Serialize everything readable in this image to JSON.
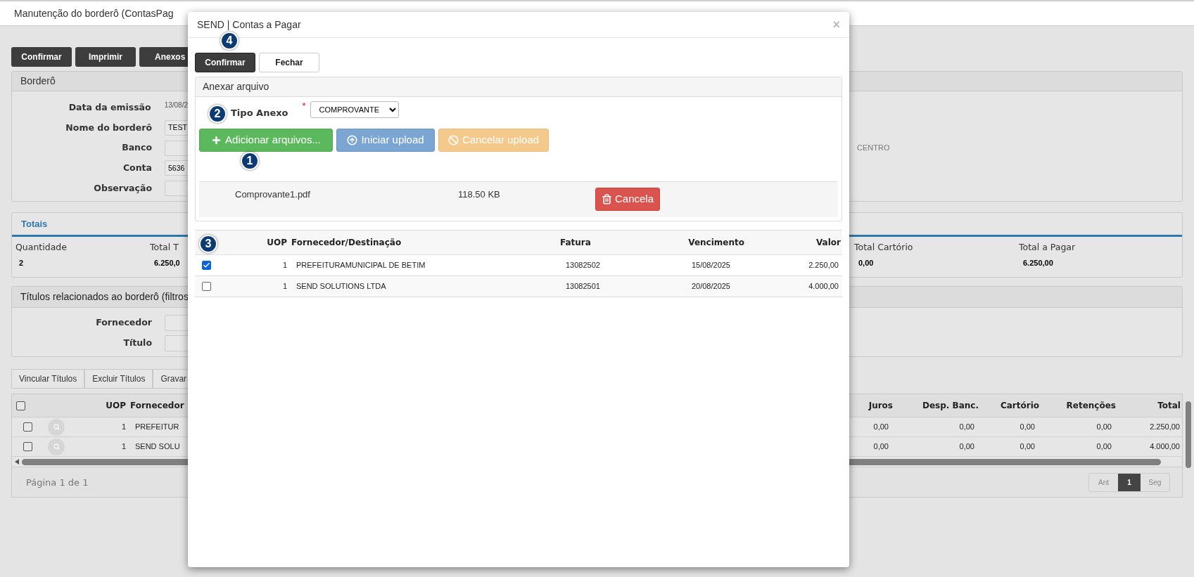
{
  "page": {
    "title": "Manutenção do borderô (ContasPag",
    "buttons": [
      "Confirmar",
      "Imprimir",
      "Anexos"
    ]
  },
  "bordero": {
    "title": "Borderô",
    "fields": [
      {
        "label": "Data da emissão",
        "kind": "text",
        "value": "13/08/2"
      },
      {
        "label": "Nome do borderô",
        "kind": "input",
        "value": "TEST"
      },
      {
        "label": "Banco",
        "kind": "input",
        "side_text": "CENTRO"
      },
      {
        "label": "Conta",
        "kind": "input",
        "value": "5636"
      },
      {
        "label": "Observação",
        "kind": "input"
      }
    ]
  },
  "totais": {
    "title": "Totais",
    "left": [
      {
        "label": "Quantidade",
        "value": "2"
      },
      {
        "label": "Total T",
        "value": "6.250,0"
      }
    ],
    "right": [
      {
        "label": "Total Cartório",
        "value": "0,00"
      },
      {
        "label": "Total a Pagar",
        "value": "6.250,00"
      }
    ]
  },
  "titulos": {
    "title": "Títulos relacionados ao borderô (filtros",
    "fields": [
      {
        "label": "Fornecedor"
      },
      {
        "label": "Título"
      }
    ]
  },
  "tabs": [
    "Vincular Títulos",
    "Excluir Títulos",
    "Gravar"
  ],
  "grid": {
    "all_checked": false,
    "left_columns": [
      "UOP",
      "Fornecedor"
    ],
    "right_columns": [
      "Juros",
      "Desp. Banc.",
      "Cartório",
      "Retenções",
      "Total"
    ],
    "rows": [
      {
        "checked": false,
        "uop": "1",
        "name": "PREFEITUR",
        "values": [
          "0,00",
          "0,00",
          "0,00",
          "0,00",
          "2.250,00"
        ]
      },
      {
        "checked": false,
        "uop": "1",
        "name": "SEND SOLU",
        "values": [
          "0,00",
          "0,00",
          "0,00",
          "0,00",
          "4.000,00"
        ]
      }
    ]
  },
  "pager": {
    "text": "Página 1 de 1",
    "pages": [
      {
        "label": "Ant",
        "selected": false
      },
      {
        "label": "1",
        "selected": true
      },
      {
        "label": "Seg",
        "selected": false
      }
    ]
  },
  "modal": {
    "title": "SEND | Contas a Pagar",
    "close": "×",
    "buttons": [
      {
        "label": "Confirmar",
        "kind": "primary"
      },
      {
        "label": "Fechar",
        "kind": "default"
      }
    ],
    "panel_title": "Anexar arquivo",
    "tipo_label": "Tipo Anexo",
    "required_mark": "*",
    "tipo_value": "COMPROVANTE",
    "upload_buttons": [
      {
        "label": "Adicionar arquivos...",
        "kind": "add"
      },
      {
        "label": "Iniciar upload",
        "kind": "start"
      },
      {
        "label": "Cancelar upload",
        "kind": "cancel"
      }
    ],
    "file": {
      "name": "Comprovante1.pdf",
      "size": "118.50 KB",
      "action": "Cancela"
    },
    "table": {
      "columns": [
        "UOP",
        "Fornecedor/Destinação",
        "Fatura",
        "Vencimento",
        "Valor"
      ],
      "rows": [
        {
          "checked": true,
          "uop": "1",
          "name": "PREFEITURAMUNICIPAL DE BETIM",
          "fatura": "13082502",
          "vencimento": "15/08/2025",
          "valor": "2.250,00"
        },
        {
          "checked": false,
          "uop": "1",
          "name": "SEND SOLUTIONS LTDA",
          "fatura": "13082501",
          "vencimento": "20/08/2025",
          "valor": "4.000,00"
        }
      ]
    },
    "badges": [
      "1",
      "2",
      "3",
      "4"
    ]
  }
}
